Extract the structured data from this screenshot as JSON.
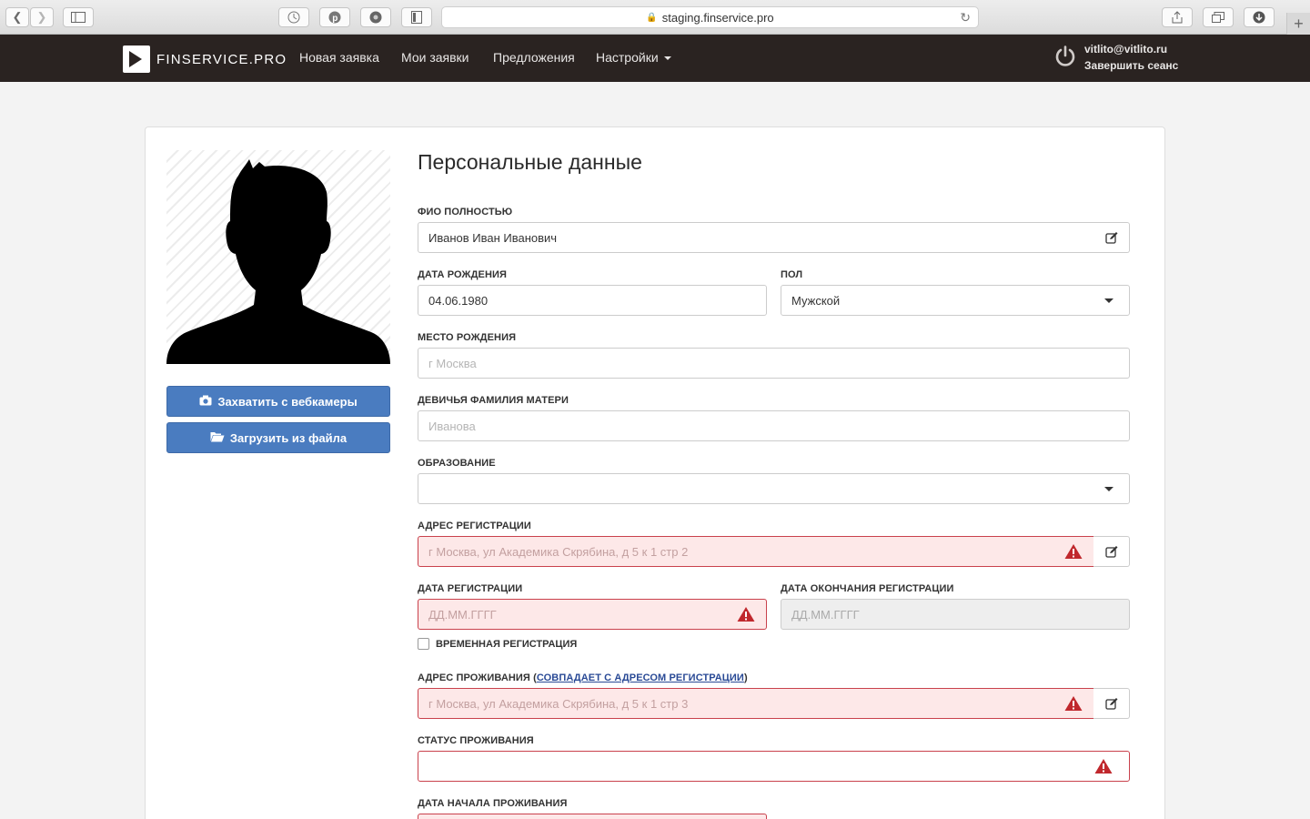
{
  "browser": {
    "url": "staging.finservice.pro"
  },
  "navbar": {
    "logo_text": "FINSERVICE.PRO",
    "items": [
      {
        "label": "Новая заявка"
      },
      {
        "label": "Мои заявки"
      },
      {
        "label": "Предложения"
      },
      {
        "label": "Настройки"
      }
    ],
    "user_email": "vitlito@vitlito.ru",
    "logout_label": "Завершить сеанс"
  },
  "sidebar": {
    "webcam_button": "Захватить с вебкамеры",
    "upload_button": "Загрузить из файла"
  },
  "form": {
    "title": "Персональные данные",
    "full_name": {
      "label": "ФИО ПОЛНОСТЬЮ",
      "value": "Иванов Иван Иванович"
    },
    "birth_date": {
      "label": "ДАТА РОЖДЕНИЯ",
      "value": "04.06.1980"
    },
    "gender": {
      "label": "ПОЛ",
      "value": "Мужской"
    },
    "birth_place": {
      "label": "МЕСТО РОЖДЕНИЯ",
      "placeholder": "г Москва"
    },
    "mother_maiden": {
      "label": "ДЕВИЧЬЯ ФАМИЛИЯ МАТЕРИ",
      "placeholder": "Иванова"
    },
    "education": {
      "label": "ОБРАЗОВАНИЕ",
      "value": ""
    },
    "reg_address": {
      "label": "АДРЕС РЕГИСТРАЦИИ",
      "placeholder": "г Москва, ул Академика Скрябина, д 5 к 1 стр 2"
    },
    "reg_date": {
      "label": "ДАТА РЕГИСТРАЦИИ",
      "placeholder": "ДД.ММ.ГГГГ"
    },
    "reg_end_date": {
      "label": "ДАТА ОКОНЧАНИЯ РЕГИСТРАЦИИ",
      "placeholder": "ДД.ММ.ГГГГ"
    },
    "temp_reg": {
      "label": "ВРЕМЕННАЯ РЕГИСТРАЦИЯ"
    },
    "live_address": {
      "label": "АДРЕС ПРОЖИВАНИЯ (",
      "link": "СОВПАДАЕТ С АДРЕСОМ РЕГИСТРАЦИИ",
      "label_end": ")",
      "placeholder": "г Москва, ул Академика Скрябина, д 5 к 1 стр 3"
    },
    "live_status": {
      "label": "СТАТУС ПРОЖИВАНИЯ",
      "value": ""
    },
    "live_start": {
      "label": "ДАТА НАЧАЛА ПРОЖИВАНИЯ"
    }
  },
  "colors": {
    "navbar": "#2a2321",
    "primary_button": "#4a7cc0",
    "error_border": "#c9414c",
    "error_bg": "#fde8e8",
    "warn_icon": "#c0282d"
  }
}
